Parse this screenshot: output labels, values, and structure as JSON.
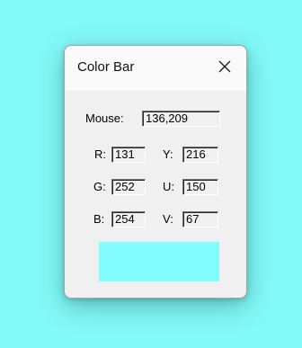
{
  "desktop": {
    "background": "#83FAF8"
  },
  "window": {
    "title": "Color Bar",
    "close_icon": "close-icon"
  },
  "mouse": {
    "label": "Mouse:",
    "value": "136,209"
  },
  "rgb": {
    "r_label": "R:",
    "r_value": "131",
    "g_label": "G:",
    "g_value": "252",
    "b_label": "B:",
    "b_value": "254"
  },
  "yuv": {
    "y_label": "Y:",
    "y_value": "216",
    "u_label": "U:",
    "u_value": "150",
    "v_label": "V:",
    "v_value": "67"
  },
  "swatch": {
    "color": "#83FCFE"
  }
}
